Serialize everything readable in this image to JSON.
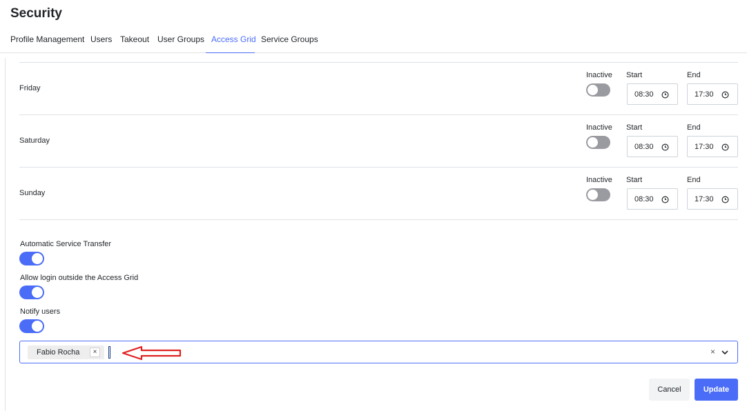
{
  "page": {
    "title": "Security"
  },
  "tabs": [
    {
      "label": "Profile Management",
      "active": false
    },
    {
      "label": "Users",
      "active": false
    },
    {
      "label": "Takeout",
      "active": false
    },
    {
      "label": "User Groups",
      "active": false
    },
    {
      "label": "Access Grid",
      "active": true
    },
    {
      "label": "Service Groups",
      "active": false
    }
  ],
  "days": [
    {
      "name": "Friday",
      "status_label": "Inactive",
      "start_label": "Start",
      "start": "08:30",
      "end_label": "End",
      "end": "17:30",
      "enabled": false
    },
    {
      "name": "Saturday",
      "status_label": "Inactive",
      "start_label": "Start",
      "start": "08:30",
      "end_label": "End",
      "end": "17:30",
      "enabled": false
    },
    {
      "name": "Sunday",
      "status_label": "Inactive",
      "start_label": "Start",
      "start": "08:30",
      "end_label": "End",
      "end": "17:30",
      "enabled": false
    }
  ],
  "settings": {
    "auto_transfer": {
      "label": "Automatic Service Transfer",
      "enabled": true
    },
    "allow_login": {
      "label": "Allow login outside the Access Grid",
      "enabled": true
    },
    "notify_users": {
      "label": "Notify users",
      "enabled": true
    }
  },
  "notify_select": {
    "selected": [
      {
        "label": "Fabio Rocha",
        "remove": "×"
      }
    ],
    "clear": "×"
  },
  "actions": {
    "cancel": "Cancel",
    "update": "Update"
  },
  "colors": {
    "accent": "#4a6cf7",
    "toggle_off": "#9a9ba0",
    "annotation": "#e02020"
  },
  "icons": {
    "time_field": "clock-icon",
    "select_dropdown": "chevron-down-icon",
    "select_clear": "close-icon",
    "annotation": "arrow-left-icon"
  }
}
